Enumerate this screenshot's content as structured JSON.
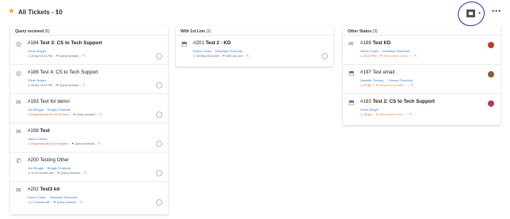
{
  "header": {
    "title": "All Tickets - 10",
    "star_icon": "star-icon",
    "more_icon": "more-horizontal-icon",
    "view_icon": "board-view-icon"
  },
  "columns": [
    {
      "title": "Query received",
      "count": "(6)",
      "cards": [
        {
          "icon": "globe-icon",
          "glyph": "◎",
          "number": "#184",
          "subject": "Test 3: CS to Tech Support",
          "bold": true,
          "contact": "Oliver Bolger",
          "company": "",
          "sla": "28 Apr 04:41 PM",
          "status": "Query received",
          "assignee": "unassigned-icon"
        },
        {
          "icon": "globe-icon",
          "glyph": "◎",
          "number": "#186",
          "subject": "Test 4: CS to Tech Support",
          "bold": false,
          "contact": "Oliver Bolger",
          "company": "",
          "sla": "28 Apr 04:42 PM",
          "status": "Query received",
          "assignee": "unassigned-icon"
        },
        {
          "icon": "mail-icon",
          "glyph": "✉",
          "number": "#193",
          "subject": "Test for demo",
          "bold": false,
          "contact": "Joe Bloggs",
          "company": "Bloggs Financial",
          "sla": "Response late by 20:26 hours",
          "status": "Query received",
          "assignee": "unassigned-icon"
        },
        {
          "icon": "mail-icon",
          "glyph": "✉",
          "number": "#198",
          "subject": "Test",
          "bold": true,
          "contact": "Jason Caines",
          "company": "",
          "sla": "Response late by 33 minutes",
          "status": "Query received",
          "assignee": "unassigned-icon"
        },
        {
          "icon": "phone-icon",
          "glyph": "✆",
          "number": "#200",
          "subject": "Testing Other",
          "bold": false,
          "contact": "Joe Bloggs",
          "company": "Bloggs Financial",
          "sla": "12:42 minutes left",
          "status": "Query received",
          "assignee": "unassigned-icon"
        },
        {
          "icon": "mail-icon",
          "glyph": "✉",
          "number": "#202",
          "subject": "Test3 kd",
          "bold": true,
          "contact": "Raven Clase",
          "company": "Delshaye Financial",
          "sla": "27 minutes left",
          "status": "Query received",
          "assignee": "unassigned-icon"
        }
      ]
    },
    {
      "title": "With 1st Line",
      "count": "(1)",
      "cards": [
        {
          "icon": "inbox-icon",
          "glyph": "⬒",
          "number": "#201",
          "subject": "Test 2 - KD",
          "bold": true,
          "contact": "Raven Clase",
          "company": "Delshaye Financial",
          "sla": "05 May 09:44 AM",
          "status": "With 1st Line",
          "assignee": "unassigned-icon"
        }
      ]
    },
    {
      "title": "Other Status",
      "count": "(3)",
      "cards": [
        {
          "icon": "mail-icon",
          "glyph": "✉",
          "number": "#199",
          "subject": "Test KD",
          "bold": true,
          "contact": "Raven Clase",
          "company": "Delshaye Financial",
          "sla": "03:27 PM",
          "status": "With adviser further...",
          "avatar_color": "#c0392b"
        },
        {
          "icon": "inbox-icon",
          "glyph": "⬒",
          "number": "#197",
          "subject": "Test email",
          "bold": false,
          "contact": "Danielle Theway",
          "company": "Theway Financial",
          "sla": "29 Apr",
          "status": "Response provided ...",
          "avatar_color": "#8e5a3c"
        },
        {
          "icon": "inbox-icon",
          "glyph": "⬒",
          "number": "#183",
          "subject": "Test 2: CS to Tech Support",
          "bold": true,
          "contact": "Oliver Bolger",
          "company": "",
          "sla": "28 Apr",
          "status": "With adviser furthe...",
          "avatar_color": "#b03a6a"
        }
      ]
    }
  ]
}
